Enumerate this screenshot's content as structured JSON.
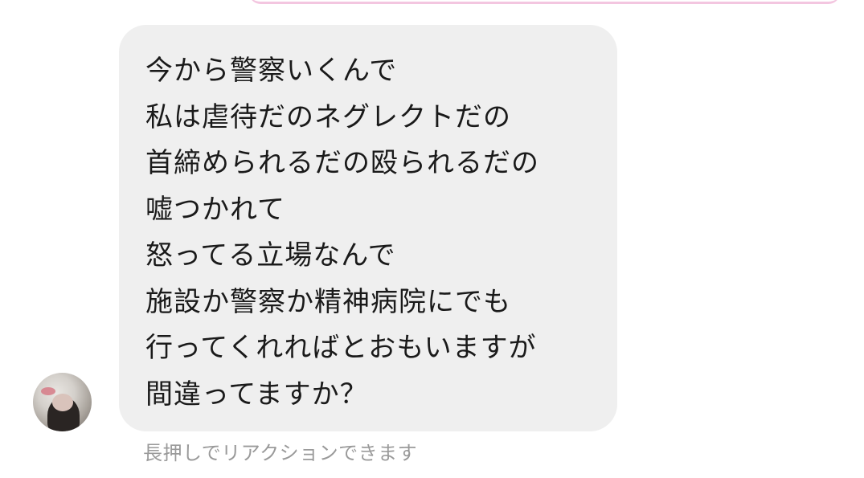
{
  "message": {
    "lines": [
      "今から警察いくんで",
      "私は虐待だのネグレクトだの",
      "首締められるだの殴られるだの",
      "嘘つかれて",
      "怒ってる立場なんで",
      "施設か警察か精神病院にでも",
      "行ってくれればとおもいますが",
      "間違ってますか？"
    ]
  },
  "hint": "長押しでリアクションできます",
  "colors": {
    "bubble_bg": "#efefef",
    "text": "#1a1a1a",
    "hint_text": "#9a9a9a",
    "outgoing_bubble_edge": "#f3c6e0"
  },
  "icons": {
    "avatar": "avatar-photo"
  }
}
